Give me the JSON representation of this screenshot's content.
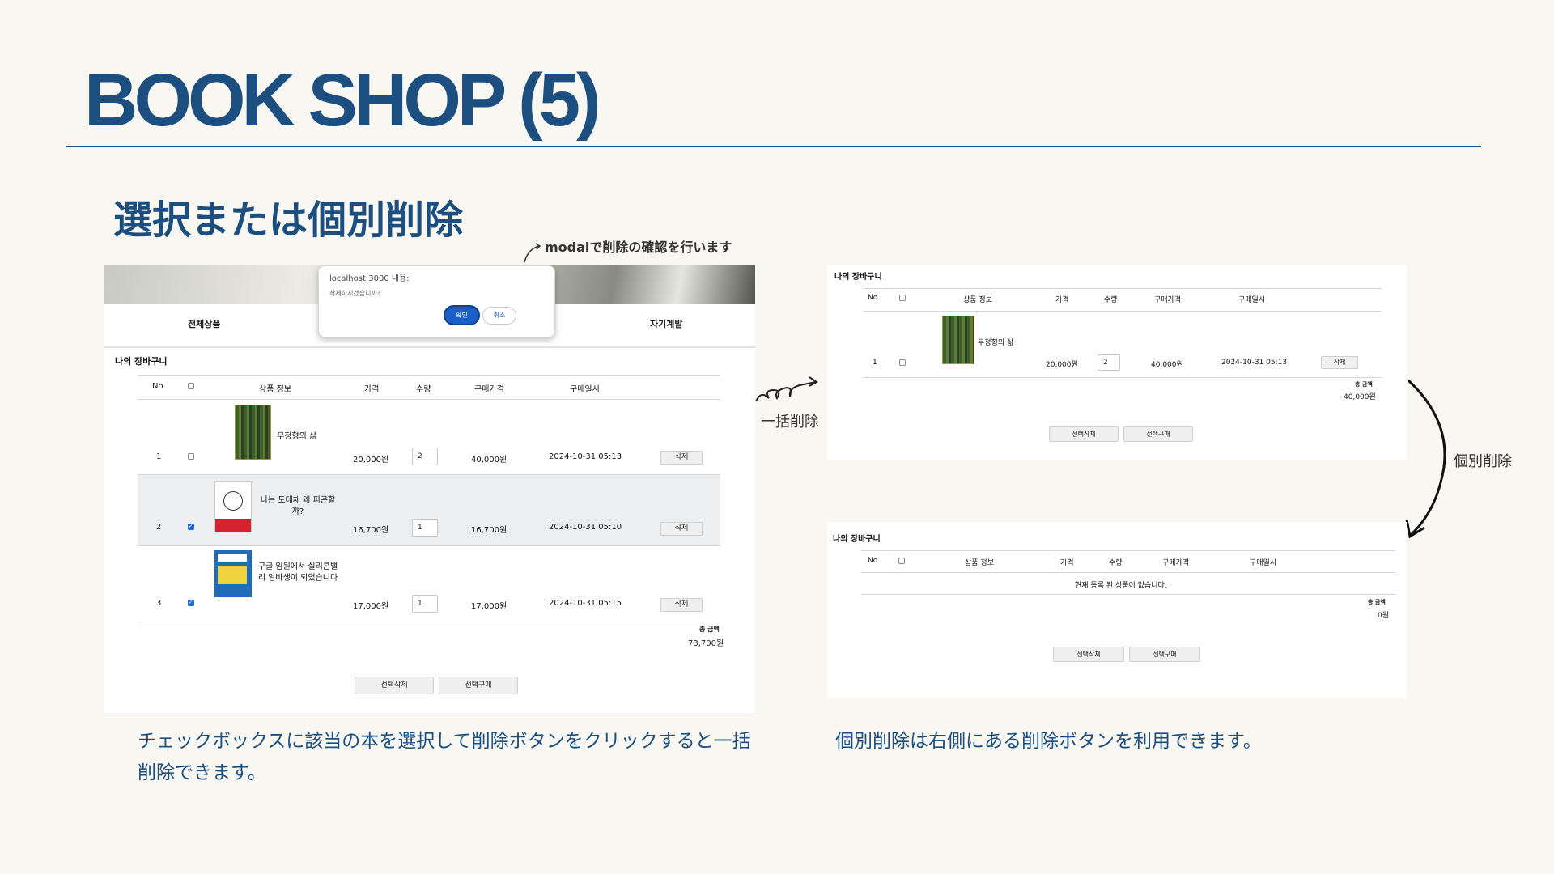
{
  "slide": {
    "title": "BOOK SHOP (5)",
    "heading": "選択または個別削除",
    "note_modal": "modalで削除の確認を行います",
    "note_bulk": "一括削除",
    "note_single": "個別削除",
    "caption_left": "チェックボックスに該当の本を選択して削除ボタンをクリックすると一括削除できます。",
    "caption_right": "個別削除は右側にある削除ボタンを利用できます。",
    "accent_color": "#1c4e80"
  },
  "main": {
    "nav": {
      "all": "전체상품",
      "self": "자기계발"
    },
    "modal": {
      "title": "localhost:3000 내용:",
      "message": "삭제하시겠습니까?",
      "ok": "확인",
      "cancel": "취소"
    },
    "cart_title": "나의 장바구니",
    "headers": {
      "no": "No",
      "info": "상품 정보",
      "price": "가격",
      "qty": "수량",
      "buy_price": "구매가격",
      "date": "구매일시"
    },
    "rows": [
      {
        "no": "1",
        "title": "무정형의 삶",
        "price": "20,000원",
        "qty": "2",
        "buy_price": "40,000원",
        "date": "2024-10-31 05:13",
        "delete": "삭제",
        "checked": false
      },
      {
        "no": "2",
        "title": "나는 도대체 왜 피곤할까?",
        "price": "16,700원",
        "qty": "1",
        "buy_price": "16,700원",
        "date": "2024-10-31 05:10",
        "delete": "삭제",
        "checked": true
      },
      {
        "no": "3",
        "title": "구글 임원에서 실리콘밸리 알바생이 되었습니다",
        "price": "17,000원",
        "qty": "1",
        "buy_price": "17,000원",
        "date": "2024-10-31 05:15",
        "delete": "삭제",
        "checked": true
      }
    ],
    "total_label": "총 금액",
    "total": "73,700원",
    "btn_delete_selected": "선택삭제",
    "btn_buy_selected": "선택구매"
  },
  "after_bulk": {
    "cart_title": "나의 장바구니",
    "headers": {
      "no": "No",
      "info": "상품 정보",
      "price": "가격",
      "qty": "수량",
      "buy_price": "구매가격",
      "date": "구매일시"
    },
    "row": {
      "no": "1",
      "title": "무정형의 삶",
      "price": "20,000원",
      "qty": "2",
      "buy_price": "40,000원",
      "date": "2024-10-31 05:13",
      "delete": "삭제"
    },
    "total_label": "총 금액",
    "total": "40,000원",
    "btn_delete_selected": "선택삭제",
    "btn_buy_selected": "선택구매"
  },
  "after_single": {
    "cart_title": "나의 장바구니",
    "headers": {
      "no": "No",
      "info": "상품 정보",
      "price": "가격",
      "qty": "수량",
      "buy_price": "구매가격",
      "date": "구매일시"
    },
    "empty_message": "현재 등록 된 상품이 없습니다.",
    "total_label": "총 금액",
    "total": "0원",
    "btn_delete_selected": "선택삭제",
    "btn_buy_selected": "선택구매"
  }
}
